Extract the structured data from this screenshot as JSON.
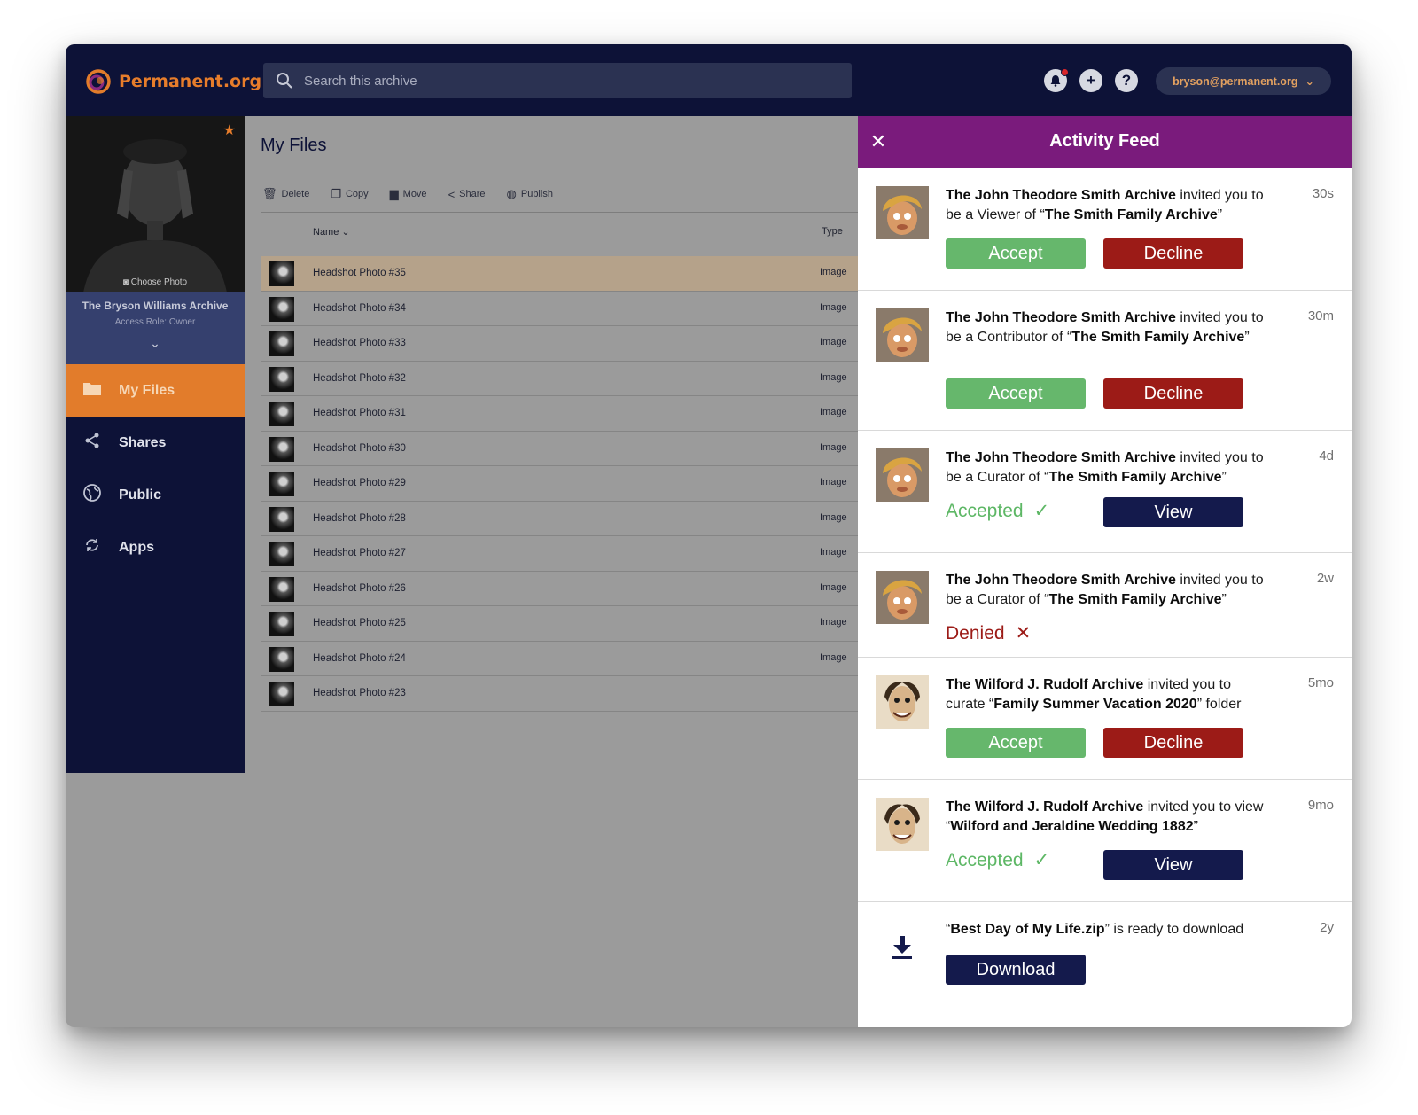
{
  "app": {
    "logo_text": "Permanent.org",
    "search_placeholder": "Search this archive",
    "account_label": "bryson@permanent.org",
    "colors": {
      "navy": "#0d1237",
      "orange": "#e27c2b",
      "purple": "#7a1b7c",
      "accept": "#66b76c",
      "decline": "#9c1b17"
    }
  },
  "sidebar": {
    "choose_photo": "Choose Photo",
    "archive_name": "The Bryson Williams Archive",
    "access_role": "Access Role: Owner",
    "items": [
      {
        "label": "My Files",
        "icon": "folder-icon"
      },
      {
        "label": "Shares",
        "icon": "share-icon"
      },
      {
        "label": "Public",
        "icon": "globe-icon"
      },
      {
        "label": "Apps",
        "icon": "sync-icon"
      }
    ]
  },
  "files": {
    "title": "My Files",
    "toolbar": {
      "delete": "Delete",
      "copy": "Copy",
      "move": "Move",
      "share": "Share",
      "publish": "Publish"
    },
    "columns": {
      "name": "Name",
      "type": "Type"
    },
    "rows": [
      {
        "name": "Headshot Photo #35",
        "type": "Image"
      },
      {
        "name": "Headshot Photo #34",
        "type": "Image"
      },
      {
        "name": "Headshot Photo #33",
        "type": "Image"
      },
      {
        "name": "Headshot Photo #32",
        "type": "Image"
      },
      {
        "name": "Headshot Photo #31",
        "type": "Image"
      },
      {
        "name": "Headshot Photo #30",
        "type": "Image"
      },
      {
        "name": "Headshot Photo #29",
        "type": "Image"
      },
      {
        "name": "Headshot Photo #28",
        "type": "Image"
      },
      {
        "name": "Headshot Photo #27",
        "type": "Image"
      },
      {
        "name": "Headshot Photo #26",
        "type": "Image"
      },
      {
        "name": "Headshot Photo #25",
        "type": "Image"
      },
      {
        "name": "Headshot Photo #24",
        "type": "Image"
      },
      {
        "name": "Headshot Photo #23",
        "type": ""
      }
    ]
  },
  "feed": {
    "title": "Activity Feed",
    "items": [
      {
        "actor": "The John Theodore Smith Archive",
        "mid": " invited you to be a Viewer of “",
        "target": "The Smith Family Archive",
        "tail": "”",
        "time": "30s",
        "accept": "Accept",
        "decline": "Decline"
      },
      {
        "actor": "The John Theodore Smith Archive",
        "mid": " invited you to be a Contributor of “",
        "target": "The Smith Family Archive",
        "tail": "”",
        "time": "30m",
        "accept": "Accept",
        "decline": "Decline"
      },
      {
        "actor": "The John Theodore Smith Archive",
        "mid": " invited you to be a Curator of “",
        "target": "The Smith Family Archive",
        "tail": "”",
        "time": "4d",
        "status": "Accepted",
        "view": "View"
      },
      {
        "actor": "The John Theodore Smith Archive",
        "mid": " invited you to be a Curator of “",
        "target": "The Smith Family Archive",
        "tail": "”",
        "time": "2w",
        "status": "Denied"
      },
      {
        "actor": "The Wilford J. Rudolf  Archive",
        "mid": " invited you to curate “",
        "target": "Family Summer Vacation 2020",
        "tail": "” folder",
        "time": "5mo",
        "accept": "Accept",
        "decline": "Decline"
      },
      {
        "actor": "The Wilford J. Rudolf  Archive",
        "mid": " invited you to view “",
        "target": "Wilford and Jeraldine Wedding 1882",
        "tail": "”",
        "time": "9mo",
        "status": "Accepted",
        "view": "View"
      },
      {
        "pre": "“",
        "file": "Best Day of My Life.zip",
        "tail": "” is ready to download",
        "time": "2y",
        "download": "Download"
      }
    ]
  }
}
